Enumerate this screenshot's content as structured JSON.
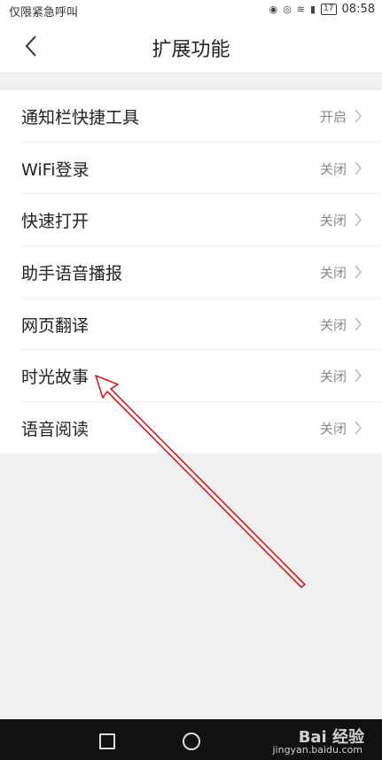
{
  "status_bar": {
    "carrier": "仅限紧急呼叫",
    "battery": "17",
    "time": "08:58"
  },
  "header": {
    "title": "扩展功能",
    "back_icon": "chevron-left-icon"
  },
  "items": [
    {
      "label": "通知栏快捷工具",
      "value": "开启"
    },
    {
      "label": "WiFi登录",
      "value": "关闭"
    },
    {
      "label": "快速打开",
      "value": "关闭"
    },
    {
      "label": "助手语音播报",
      "value": "关闭"
    },
    {
      "label": "网页翻译",
      "value": "关闭"
    },
    {
      "label": "时光故事",
      "value": "关闭"
    },
    {
      "label": "语音阅读",
      "value": "关闭"
    }
  ],
  "watermark": {
    "brand": "Bai 经验",
    "url": "jingyan.baidu.com"
  },
  "colors": {
    "annotation_arrow": "#cc1f1f",
    "background": "#f0f0f0"
  }
}
